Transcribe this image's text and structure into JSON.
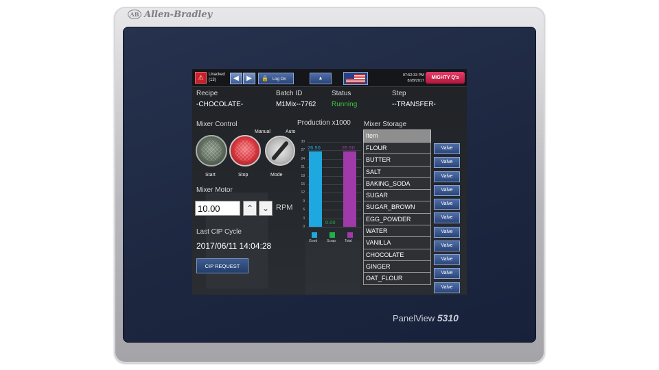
{
  "device": {
    "brand": "Allen-Bradley",
    "brand_mark": "AB",
    "model_prefix": "PanelView",
    "model_number": "5310"
  },
  "topbar": {
    "alarm_icon": "bell-icon",
    "unacked_label": "Unacked",
    "unacked_count": "(13)",
    "back_icon": "arrow-left-icon",
    "forward_icon": "arrow-right-icon",
    "logon_label": "Log On",
    "lock_icon": "lock-icon",
    "up_icon": "triangle-up-icon",
    "flag_icon": "us-flag-icon",
    "time": "07:52:33 PM",
    "date": "8/28/2017",
    "logo_text": "MIGHTY Q's"
  },
  "batch": {
    "recipe_label": "Recipe",
    "recipe_value": "-CHOCOLATE-",
    "batch_label": "Batch ID",
    "batch_value": "M1Mix--7762",
    "status_label": "Status",
    "status_value": "Running",
    "step_label": "Step",
    "step_value": "--TRANSFER-"
  },
  "mixer_control": {
    "title": "Mixer Control",
    "start_label": "Start",
    "stop_label": "Stop",
    "mode_label": "Mode",
    "manual_label": "Manual",
    "auto_label": "Auto"
  },
  "mixer_motor": {
    "title": "Mixer Motor",
    "speed_value": "10.00",
    "unit": "RPM"
  },
  "cip": {
    "title": "Last CIP Cycle",
    "timestamp": "2017/06/11 14:04:28",
    "button_label": "CIP REQUEST"
  },
  "chart_data": {
    "type": "bar",
    "title": "Production x1000",
    "categories": [
      "Good",
      "Scrap",
      "Total"
    ],
    "values": [
      26.5,
      0.0,
      26.5
    ],
    "value_labels": [
      "26.50",
      "0.00",
      "26.50"
    ],
    "colors": [
      "#1fa8e0",
      "#22b04a",
      "#a03aa8"
    ],
    "ylim": [
      0,
      30
    ],
    "yticks": [
      "30",
      "27",
      "24",
      "21",
      "18",
      "15",
      "12",
      "9",
      "6",
      "3",
      "0"
    ],
    "grid": true
  },
  "storage": {
    "title": "Mixer Storage",
    "header": "Item",
    "valve_label": "Valve",
    "items": [
      "FLOUR",
      "BUTTER",
      "SALT",
      "BAKING_SODA",
      "SUGAR",
      "SUGAR_BROWN",
      "EGG_POWDER",
      "WATER",
      "VANILLA",
      "CHOCOLATE",
      "GINGER",
      "OAT_FLOUR"
    ]
  }
}
